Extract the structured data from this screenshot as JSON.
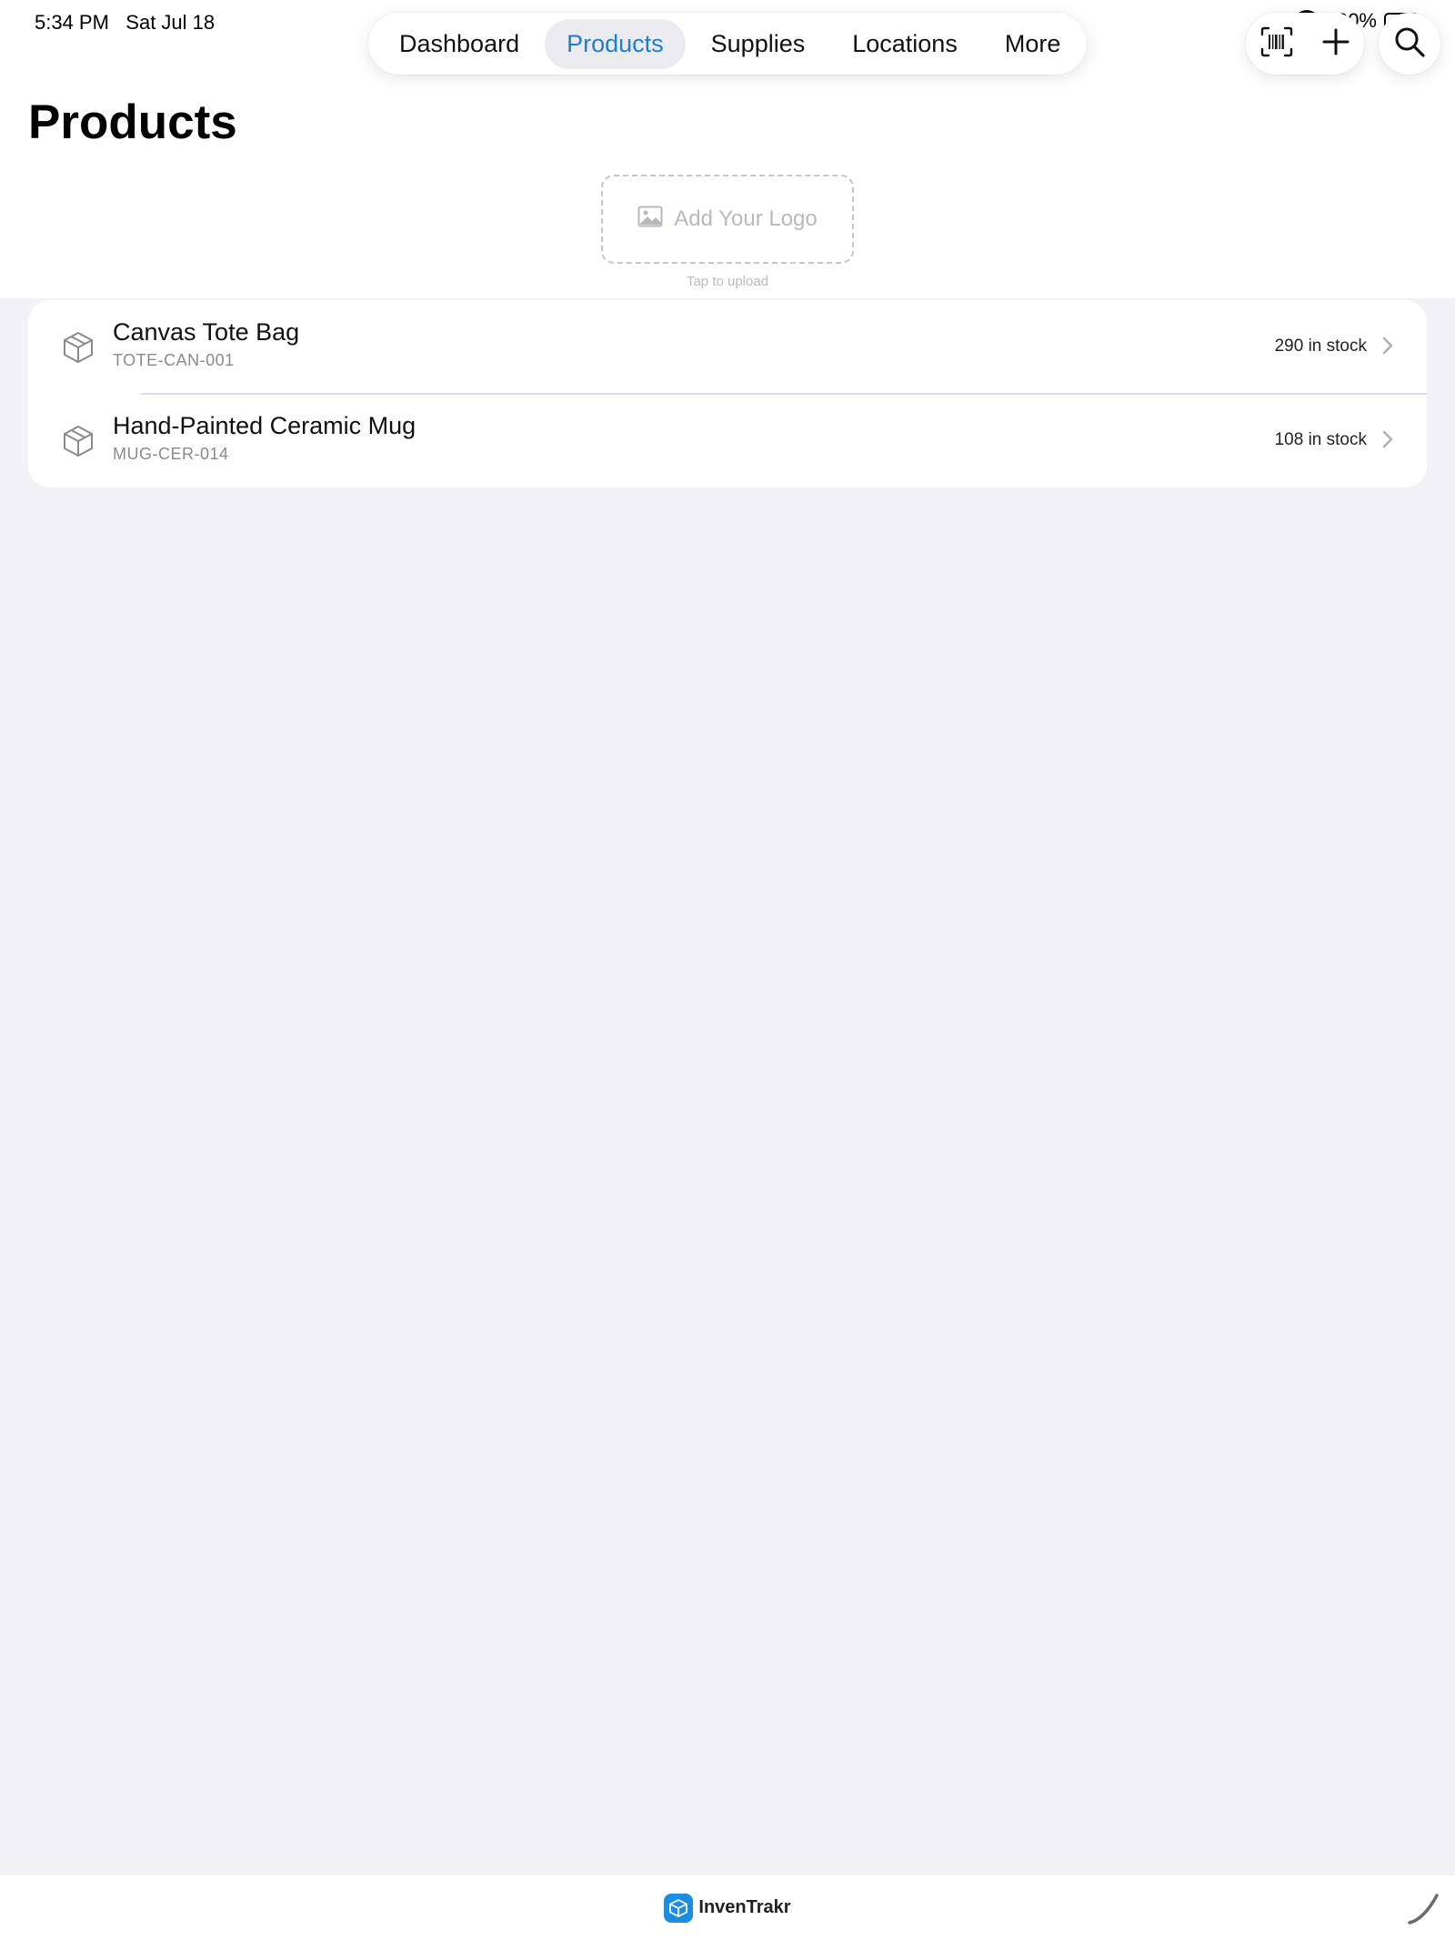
{
  "status_bar": {
    "time": "5:34 PM",
    "date": "Sat Jul 18",
    "battery": "100%"
  },
  "nav": {
    "tabs": [
      {
        "label": "Dashboard"
      },
      {
        "label": "Products"
      },
      {
        "label": "Supplies"
      },
      {
        "label": "Locations"
      },
      {
        "label": "More"
      }
    ],
    "active_tab": "Products"
  },
  "actions": {
    "scan_icon": "barcode-scan-icon",
    "add_icon": "plus-icon",
    "search_icon": "search-icon"
  },
  "page": {
    "title": "Products"
  },
  "logo_upload": {
    "label": "Add Your Logo",
    "hint": "Tap to upload"
  },
  "products": [
    {
      "name": "Canvas Tote Bag",
      "sku": "TOTE-CAN-001",
      "stock": "290 in stock"
    },
    {
      "name": "Hand-Painted Ceramic Mug",
      "sku": "MUG-CER-014",
      "stock": "108 in stock"
    }
  ],
  "footer": {
    "brand": "InvenTrakr"
  },
  "colors": {
    "accent": "#1c7dd1",
    "background": "#f1f1f6",
    "brand": "#1d8de0"
  }
}
